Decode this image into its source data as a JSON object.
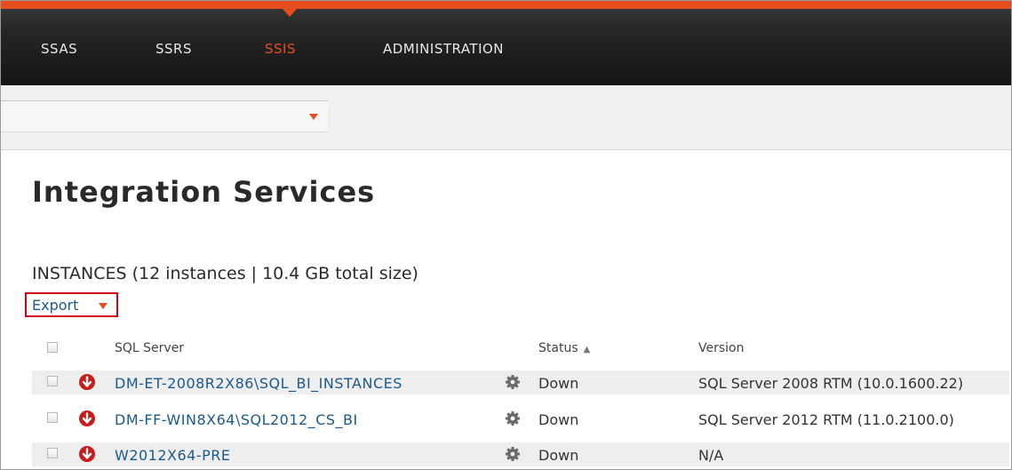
{
  "nav": {
    "items": [
      {
        "label": "SSAS",
        "active": false
      },
      {
        "label": "SSRS",
        "active": false
      },
      {
        "label": "SSIS",
        "active": true
      },
      {
        "label": "ADMINISTRATION",
        "active": false
      }
    ]
  },
  "filter": {
    "selected": ""
  },
  "page": {
    "title": "Integration Services",
    "summary": "INSTANCES (12 instances | 10.4 GB total size)",
    "export_label": "Export"
  },
  "table": {
    "headers": {
      "name": "SQL Server",
      "status": "Status",
      "version": "Version"
    },
    "sort_indicator": "▲",
    "rows": [
      {
        "name": "DM-ET-2008R2X86\\SQL_BI_INSTANCES",
        "status": "Down",
        "version": "SQL Server 2008 RTM (10.0.1600.22)",
        "status_icon": "down-arrow-icon"
      },
      {
        "name": "DM-FF-WIN8X64\\SQL2012_CS_BI",
        "status": "Down",
        "version": "SQL Server 2012 RTM (11.0.2100.0)",
        "status_icon": "down-arrow-icon"
      },
      {
        "name": "W2012X64-PRE",
        "status": "Down",
        "version": "N/A",
        "status_icon": "down-arrow-icon"
      }
    ]
  },
  "colors": {
    "accent": "#e64d1e",
    "link": "#1c5a8c",
    "down": "#c81d1d",
    "highlight_box": "#d0021b"
  }
}
